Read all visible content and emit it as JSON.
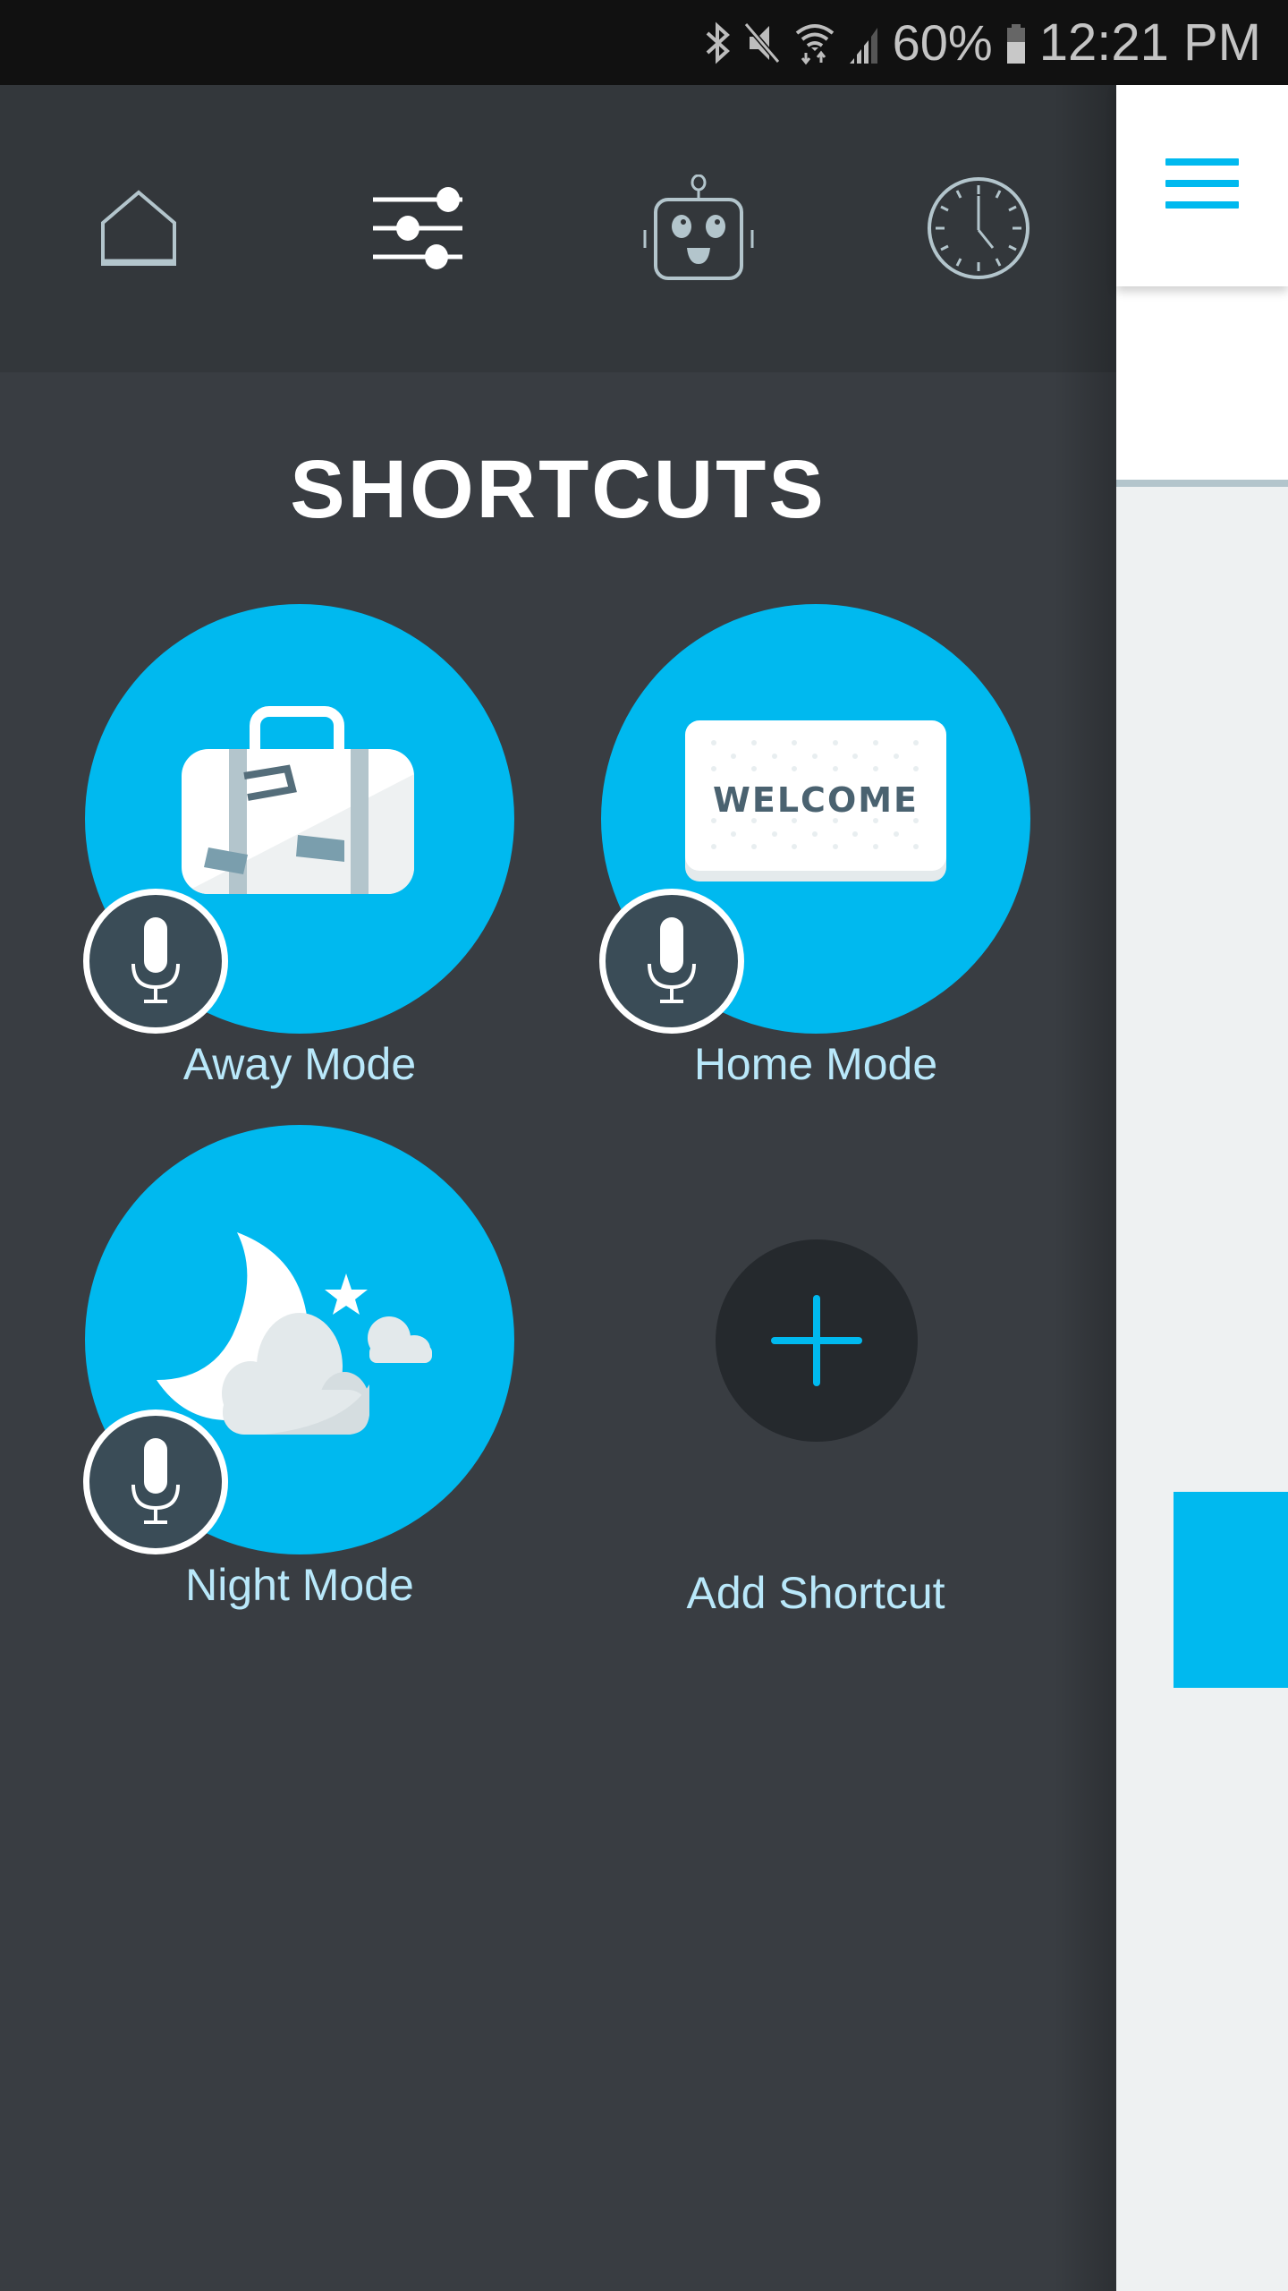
{
  "status_bar": {
    "icons": [
      "bluetooth-icon",
      "mute-icon",
      "wifi-icon",
      "signal-icon",
      "battery-icon"
    ],
    "battery_percent": "60%",
    "time": "12:21 PM"
  },
  "drawer": {
    "nav_tabs": [
      {
        "name": "home",
        "icon": "house-icon"
      },
      {
        "name": "shortcuts",
        "icon": "sliders-icon",
        "active": true
      },
      {
        "name": "robot",
        "icon": "robot-icon"
      },
      {
        "name": "schedule",
        "icon": "clock-icon"
      }
    ],
    "title": "SHORTCUTS",
    "shortcuts": [
      {
        "label": "Away Mode",
        "icon": "suitcase-icon",
        "voice": true
      },
      {
        "label": "Home Mode",
        "icon": "welcome-mat-icon",
        "mat_text": "WELCOME",
        "voice": true
      },
      {
        "label": "Night Mode",
        "icon": "moon-cloud-icon",
        "voice": true
      }
    ],
    "add_shortcut": {
      "label": "Add Shortcut",
      "icon": "plus-icon"
    }
  },
  "main_panel": {
    "menu_icon": "hamburger-icon"
  },
  "colors": {
    "accent": "#00b9ef",
    "drawer_bg": "#393d42",
    "nav_bg": "#33373b",
    "label": "#b9e8fa",
    "mic_badge": "#3a4c57"
  }
}
